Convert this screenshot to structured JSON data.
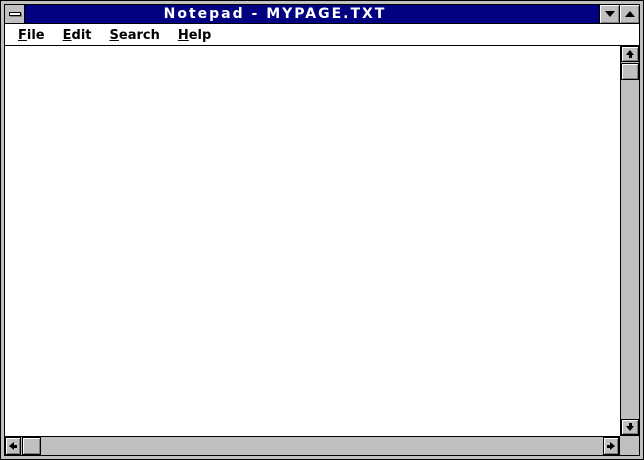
{
  "window": {
    "title": "Notepad - MYPAGE.TXT",
    "controls": {
      "system_menu_icon": "window-control-minus",
      "minimize_icon": "triangle-down",
      "maximize_icon": "triangle-up"
    },
    "colors": {
      "title_bar_bg": "#000080",
      "title_bar_text": "#ffffff",
      "chrome_gray": "#c0c0c0",
      "chrome_shadow": "#808080",
      "menu_bg": "#ffffff",
      "editor_bg": "#ffffff",
      "border_black": "#000000"
    }
  },
  "menubar": {
    "items": [
      {
        "label": "File"
      },
      {
        "label": "Edit"
      },
      {
        "label": "Search"
      },
      {
        "label": "Help"
      }
    ]
  },
  "editor": {
    "text": ""
  },
  "scrollbars": {
    "vertical": {
      "up_icon": "arrow-up",
      "down_icon": "arrow-down"
    },
    "horizontal": {
      "left_icon": "arrow-left",
      "right_icon": "arrow-right"
    }
  }
}
